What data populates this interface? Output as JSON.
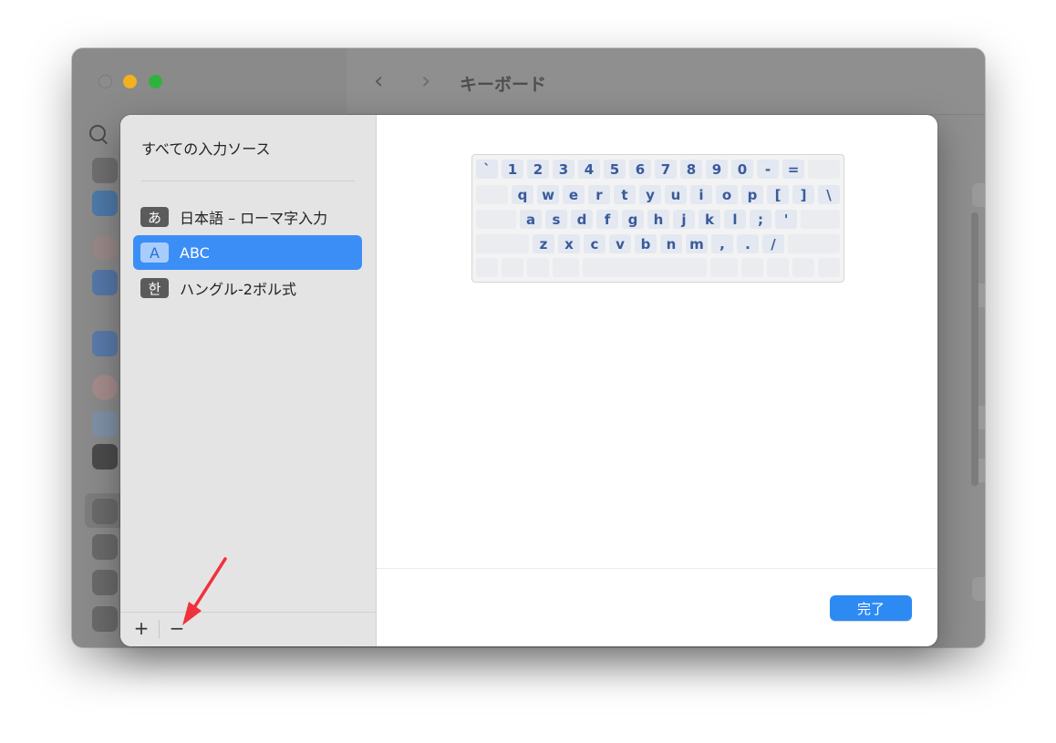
{
  "window": {
    "title": "キーボード",
    "back_glyph": "‹",
    "forward_glyph": "›"
  },
  "sheet": {
    "sidebar_heading": "すべての入力ソース",
    "sources": [
      {
        "icon_text": "あ",
        "label": "日本語 – ローマ字入力",
        "selected": false
      },
      {
        "icon_text": "A",
        "label": "ABC",
        "selected": true
      },
      {
        "icon_text": "한",
        "label": "ハングル-2ボル式",
        "selected": false
      }
    ],
    "add_label": "+",
    "remove_label": "−",
    "done_label": "完了",
    "accent_color": "#3b8ef6"
  },
  "keyboard": {
    "rows": [
      [
        "`",
        "1",
        "2",
        "3",
        "4",
        "5",
        "6",
        "7",
        "8",
        "9",
        "0",
        "-",
        "="
      ],
      [
        "q",
        "w",
        "e",
        "r",
        "t",
        "y",
        "u",
        "i",
        "o",
        "p",
        "[",
        "]",
        "\\"
      ],
      [
        "a",
        "s",
        "d",
        "f",
        "g",
        "h",
        "j",
        "k",
        "l",
        ";",
        "'"
      ],
      [
        "z",
        "x",
        "c",
        "v",
        "b",
        "n",
        "m",
        ",",
        ".",
        "/"
      ]
    ]
  },
  "annotation": {
    "arrow_color": "#f0323d"
  }
}
